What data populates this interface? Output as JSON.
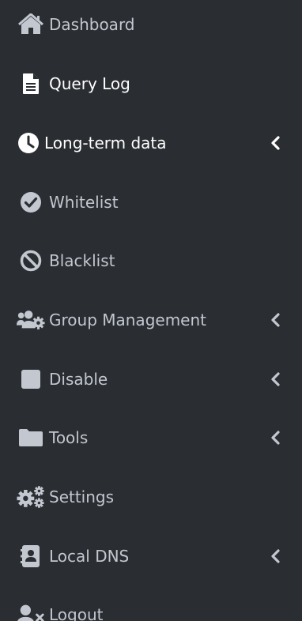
{
  "sidebar": {
    "items": [
      {
        "label": "Dashboard",
        "icon": "home-icon"
      },
      {
        "label": "Query Log",
        "icon": "document-icon"
      },
      {
        "label": "Long-term data",
        "icon": "clock-icon",
        "has_submenu": true
      },
      {
        "label": "Whitelist",
        "icon": "check-circle-icon"
      },
      {
        "label": "Blacklist",
        "icon": "ban-icon"
      },
      {
        "label": "Group Management",
        "icon": "users-cog-icon",
        "has_submenu": true
      },
      {
        "label": "Disable",
        "icon": "stop-square-icon",
        "has_submenu": true
      },
      {
        "label": "Tools",
        "icon": "folder-icon",
        "has_submenu": true
      },
      {
        "label": "Settings",
        "icon": "cogs-icon"
      },
      {
        "label": "Local DNS",
        "icon": "address-book-icon",
        "has_submenu": true
      },
      {
        "label": "Logout",
        "icon": "user-times-icon"
      }
    ]
  },
  "colors": {
    "background": "#2a2d31",
    "text": "#c2c7d0",
    "active_text": "#ffffff"
  }
}
